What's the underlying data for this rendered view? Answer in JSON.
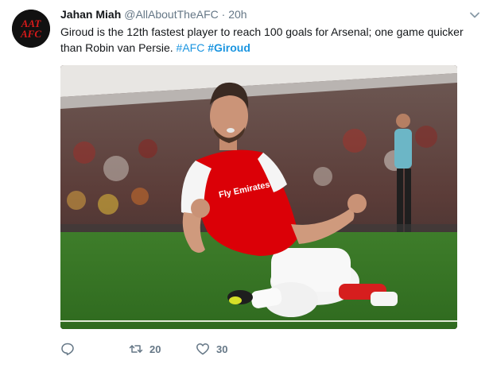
{
  "tweet": {
    "author": {
      "name": "Jahan Miah",
      "handle": "@AllAboutTheAFC",
      "separator": "·",
      "time": "20h",
      "avatar_text_top": "AAT",
      "avatar_text_bottom": "AFC"
    },
    "text": {
      "body": "Giroud is the 12th fastest player to reach 100 goals for Arsenal; one game quicker than Robin van Persie. ",
      "hashtag_plain": "#AFC",
      "hashtag_bold": "#Giroud"
    },
    "media": {
      "shirt_sponsor": "Fly Emirates",
      "icon": "photo"
    },
    "actions": {
      "reply_icon": "reply-icon",
      "retweet_icon": "retweet-icon",
      "retweet_count": "20",
      "like_icon": "heart-icon",
      "like_count": "30"
    },
    "colors": {
      "link": "#1b95e0",
      "meta": "#657786",
      "arsenal_red": "#db0007"
    }
  }
}
